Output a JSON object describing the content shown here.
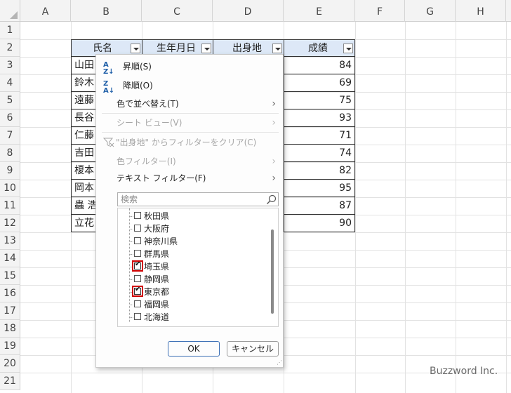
{
  "columns": [
    "A",
    "B",
    "C",
    "D",
    "E",
    "F",
    "G",
    "H"
  ],
  "rows": [
    "1",
    "2",
    "3",
    "4",
    "5",
    "6",
    "7",
    "8",
    "9",
    "10",
    "11",
    "12",
    "13",
    "14",
    "15",
    "16",
    "17",
    "18",
    "19",
    "20",
    "21"
  ],
  "table": {
    "headers": [
      "氏名",
      "生年月日",
      "出身地",
      "成績"
    ],
    "names": [
      "山田",
      "鈴木",
      "遠藤",
      "長谷",
      "仁藤",
      "吉田",
      "榎本",
      "岡本",
      "蟲 浩",
      "立花"
    ],
    "scores": [
      "84",
      "69",
      "75",
      "93",
      "71",
      "74",
      "82",
      "95",
      "87",
      "90"
    ]
  },
  "menu": {
    "sort_asc": "昇順(S)",
    "sort_desc": "降順(O)",
    "sort_by_color": "色で並べ替え(T)",
    "sheet_view": "シート ビュー(V)",
    "clear_filter": "\"出身地\" からフィルターをクリア(C)",
    "color_filter": "色フィルター(I)",
    "text_filter": "テキスト フィルター(F)",
    "search_placeholder": "検索",
    "items": [
      {
        "label": "秋田県",
        "checked": false
      },
      {
        "label": "大阪府",
        "checked": false
      },
      {
        "label": "神奈川県",
        "checked": false
      },
      {
        "label": "群馬県",
        "checked": false
      },
      {
        "label": "埼玉県",
        "checked": true
      },
      {
        "label": "静岡県",
        "checked": false
      },
      {
        "label": "東京都",
        "checked": true
      },
      {
        "label": "福岡県",
        "checked": false
      },
      {
        "label": "北海道",
        "checked": false
      }
    ],
    "ok_label": "OK",
    "cancel_label": "キャンセル"
  },
  "watermark": "Buzzword Inc."
}
